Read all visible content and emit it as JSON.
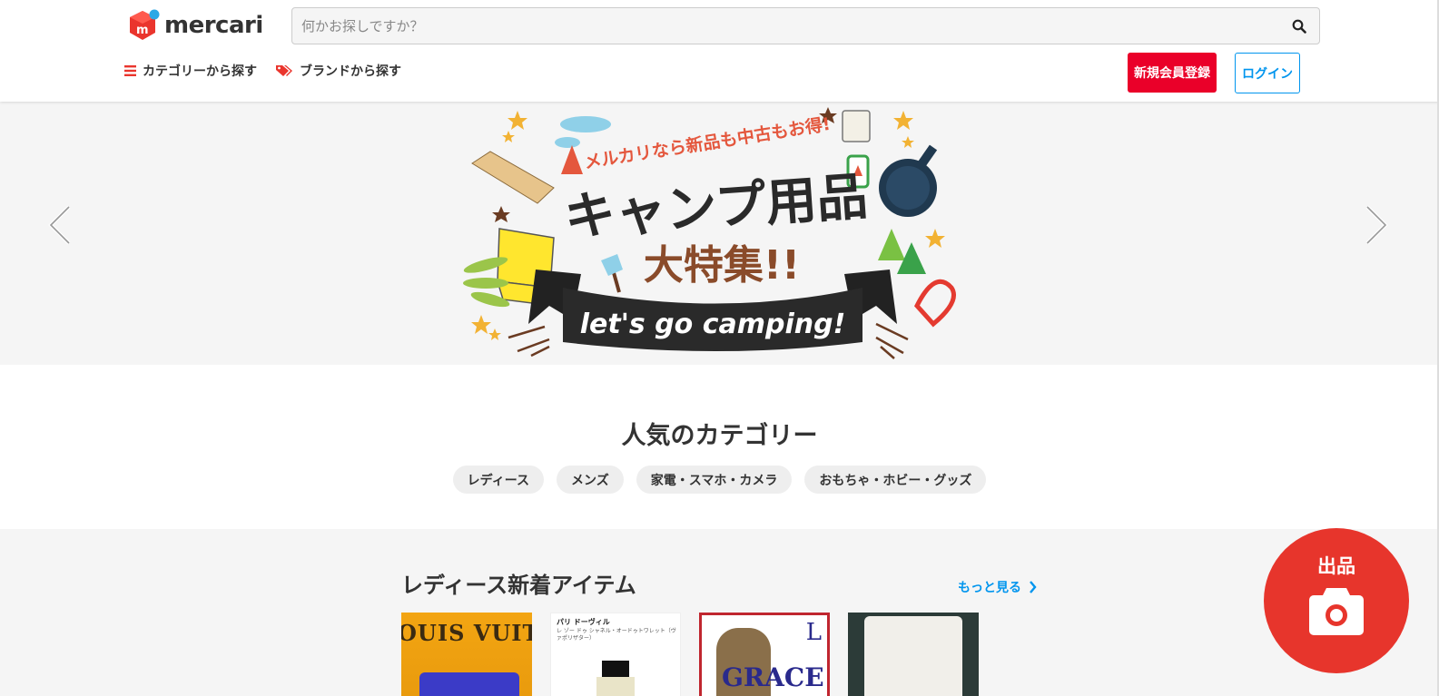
{
  "header": {
    "logo_text": "mercari",
    "search_placeholder": "何かお探しですか？",
    "nav": {
      "category": "カテゴリーから探す",
      "brand": "ブランドから探す"
    },
    "signup_label": "新規会員登録",
    "login_label": "ログイン"
  },
  "banner": {
    "headline_top": "メルカリなら新品も中古もお得!",
    "headline_main": "キャンプ用品",
    "headline_sub": "大特集!!",
    "ribbon_text": "let's go camping!"
  },
  "categories": {
    "title": "人気のカテゴリー",
    "items": [
      "レディース",
      "メンズ",
      "家電・スマホ・カメラ",
      "おもちゃ・ホビー・グッズ"
    ]
  },
  "new_items": {
    "title": "レディース新着アイテム",
    "more_label": "もっと見る",
    "thumbs": {
      "t1_text": "OUIS VUITTO",
      "t2_title": "パリ ドーヴィル",
      "t2_sub": "レ ゾー ドゥ シャネル・オードゥトワレット（ヴァポリザター）",
      "t3_big": "L",
      "t3_text": "GRACE"
    }
  },
  "fab": {
    "label": "出品"
  },
  "colors": {
    "brand_red": "#ea0029",
    "link_blue": "#0095ee",
    "fab_red": "#e7352c"
  }
}
